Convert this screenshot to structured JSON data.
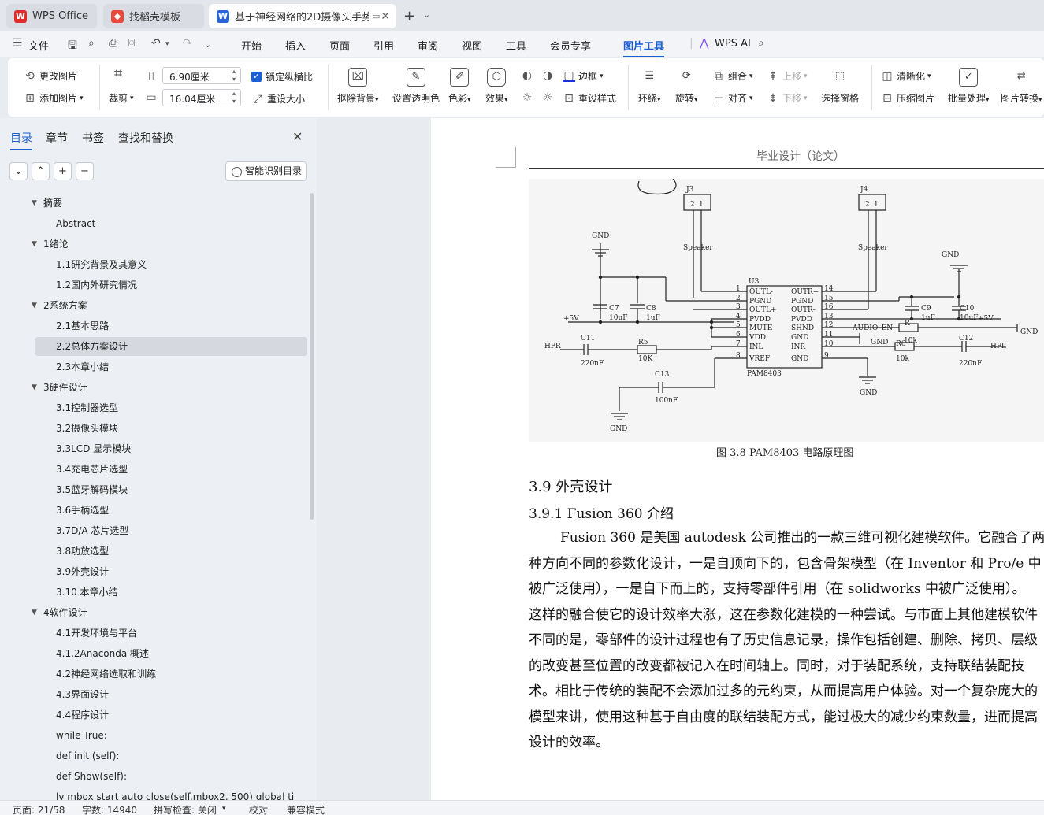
{
  "tabs": [
    {
      "label": "WPS Office",
      "icon": "wps-logo-icon"
    },
    {
      "label": "找稻壳模板",
      "icon": "docer-icon"
    },
    {
      "label": "基于神经网络的2D摄像头手势",
      "icon": "word-icon"
    }
  ],
  "tabbar": {
    "new_tab": "+",
    "dropdown": "⌄"
  },
  "menu": {
    "file": "文件",
    "items": [
      "开始",
      "插入",
      "页面",
      "引用",
      "审阅",
      "视图",
      "工具",
      "会员专享",
      "图片工具"
    ],
    "active": "图片工具",
    "wps_ai": "WPS AI"
  },
  "ribbon": {
    "change_image": "更改图片",
    "add_image": "添加图片",
    "crop": "裁剪",
    "width": "6.90厘米",
    "height": "16.04厘米",
    "lock_ratio": "锁定纵横比",
    "reset_size": "重设大小",
    "remove_bg": "抠除背景",
    "set_transparent": "设置透明色",
    "color": "色彩",
    "effect": "效果",
    "border": "边框",
    "reset_style": "重设样式",
    "wrap": "环绕",
    "rotate": "旋转",
    "group": "组合",
    "align": "对齐",
    "move_up": "上移",
    "move_down": "下移",
    "select_pane": "选择窗格",
    "sharpen": "清晰化",
    "compress": "压缩图片",
    "batch": "批量处理",
    "convert": "图片转换"
  },
  "nav": {
    "tabs": [
      "目录",
      "章节",
      "书签",
      "查找和替换"
    ],
    "smart_btn": "智能识别目录"
  },
  "toc": [
    {
      "label": "摘要",
      "level": 1,
      "expanded": true
    },
    {
      "label": "Abstract",
      "level": 2
    },
    {
      "label": "1绪论",
      "level": 1,
      "expanded": true
    },
    {
      "label": "1.1研究背景及其意义",
      "level": 2
    },
    {
      "label": "1.2国内外研究情况",
      "level": 2
    },
    {
      "label": "2系统方案",
      "level": 1,
      "expanded": true
    },
    {
      "label": "2.1基本思路",
      "level": 2
    },
    {
      "label": "2.2总体方案设计",
      "level": 2,
      "selected": true
    },
    {
      "label": "2.3本章小结",
      "level": 2
    },
    {
      "label": "3硬件设计",
      "level": 1,
      "expanded": true
    },
    {
      "label": "3.1控制器选型",
      "level": 2
    },
    {
      "label": "3.2摄像头模块",
      "level": 2
    },
    {
      "label": "3.3LCD 显示模块",
      "level": 2
    },
    {
      "label": "3.4充电芯片选型",
      "level": 2
    },
    {
      "label": "3.5蓝牙解码模块",
      "level": 2
    },
    {
      "label": "3.6手柄选型",
      "level": 2
    },
    {
      "label": "3.7D/A 芯片选型",
      "level": 2
    },
    {
      "label": "3.8功放选型",
      "level": 2
    },
    {
      "label": "3.9外壳设计",
      "level": 2
    },
    {
      "label": "3.10 本章小结",
      "level": 2
    },
    {
      "label": "4软件设计",
      "level": 1,
      "expanded": true
    },
    {
      "label": "4.1开发环境与平台",
      "level": 2
    },
    {
      "label": "4.1.2Anaconda 概述",
      "level": 2
    },
    {
      "label": "4.2神经网络选取和训练",
      "level": 2
    },
    {
      "label": "4.3界面设计",
      "level": 2
    },
    {
      "label": "4.4程序设计",
      "level": 2
    },
    {
      "label": "while True:",
      "level": 2
    },
    {
      "label": "def init (self):",
      "level": 2
    },
    {
      "label": "def Show(self):",
      "level": 2
    },
    {
      "label": "lv mbox start auto close(self.mbox2, 500) global ti",
      "level": 2
    }
  ],
  "document": {
    "header": "毕业设计（论文）",
    "figure_caption": "图 3.8 PAM8403 电路原理图",
    "section": "3.9   外壳设计",
    "subsection": "3.9.1   Fusion 360 介绍",
    "lines": [
      "Fusion 360 是美国 autodesk 公司推出的一款三维可视化建模软件。它融合了两",
      "种方向不同的参数化设计，一是自顶向下的，包含骨架模型（在 Inventor 和 Pro/e 中",
      "被广泛使用），一是自下而上的，支持零部件引用（在 solidworks 中被广泛使用）。",
      "这样的融合使它的设计效率大涨，这在参数化建模的一种尝试。与市面上其他建模软件",
      "不同的是，零部件的设计过程也有了历史信息记录，操作包括创建、删除、拷贝、层级",
      "的改变甚至位置的改变都被记入在时间轴上。同时，对于装配系统，支持联结装配技",
      "术。相比于传统的装配不会添加过多的元约束，从而提高用户体验。对一个复杂庞大的",
      "模型来讲，使用这种基于自由度的联结装配方式，能过极大的减少约束数量，进而提高",
      "设计的效率。"
    ]
  },
  "schematic": {
    "chip": "U3",
    "chip_name": "PAM8403",
    "left_pins": [
      "OUTL-",
      "PGND",
      "OUTL+",
      "PVDD",
      "MUTE",
      "VDD",
      "INL",
      "VREF"
    ],
    "left_nums": [
      "1",
      "2",
      "3",
      "4",
      "5",
      "6",
      "7",
      "8"
    ],
    "right_pins": [
      "OUTR+",
      "PGND",
      "OUTR-",
      "PVDD",
      "SHND",
      "GND",
      "INR",
      "GND"
    ],
    "right_nums": [
      "14",
      "15",
      "16",
      "13",
      "12",
      "11",
      "10",
      "9"
    ],
    "labels": {
      "j3": "J3",
      "j4": "J4",
      "spk1": "Speaker",
      "spk2": "Speaker",
      "gnd": "GND",
      "p5v_left": "+5V",
      "p5v_right": "+5V",
      "c7": "C7",
      "c7v": "10uF",
      "c8": "C8",
      "c8v": "1uF",
      "c9": "C9",
      "c9v": "1uF",
      "c10": "C10",
      "c10v": "10uF",
      "c11": "C11",
      "c11v": "220nF",
      "c12": "C12",
      "c12v": "220nF",
      "c13": "C13",
      "c13v": "100nF",
      "r5": "R5",
      "r5v": "10K",
      "r6": "R6",
      "r6v": "10k",
      "r4": "R",
      "r4v": "10k",
      "hpr": "HPR",
      "hpl": "HPL",
      "audio_en": "AUDIO_EN",
      "pin2": "2",
      "pin1": "1"
    }
  },
  "status": {
    "page": "页面: 21/58",
    "words": "字数: 14940",
    "spell": "拼写检查: 关闭",
    "proof": "校对",
    "compat": "兼容模式"
  }
}
